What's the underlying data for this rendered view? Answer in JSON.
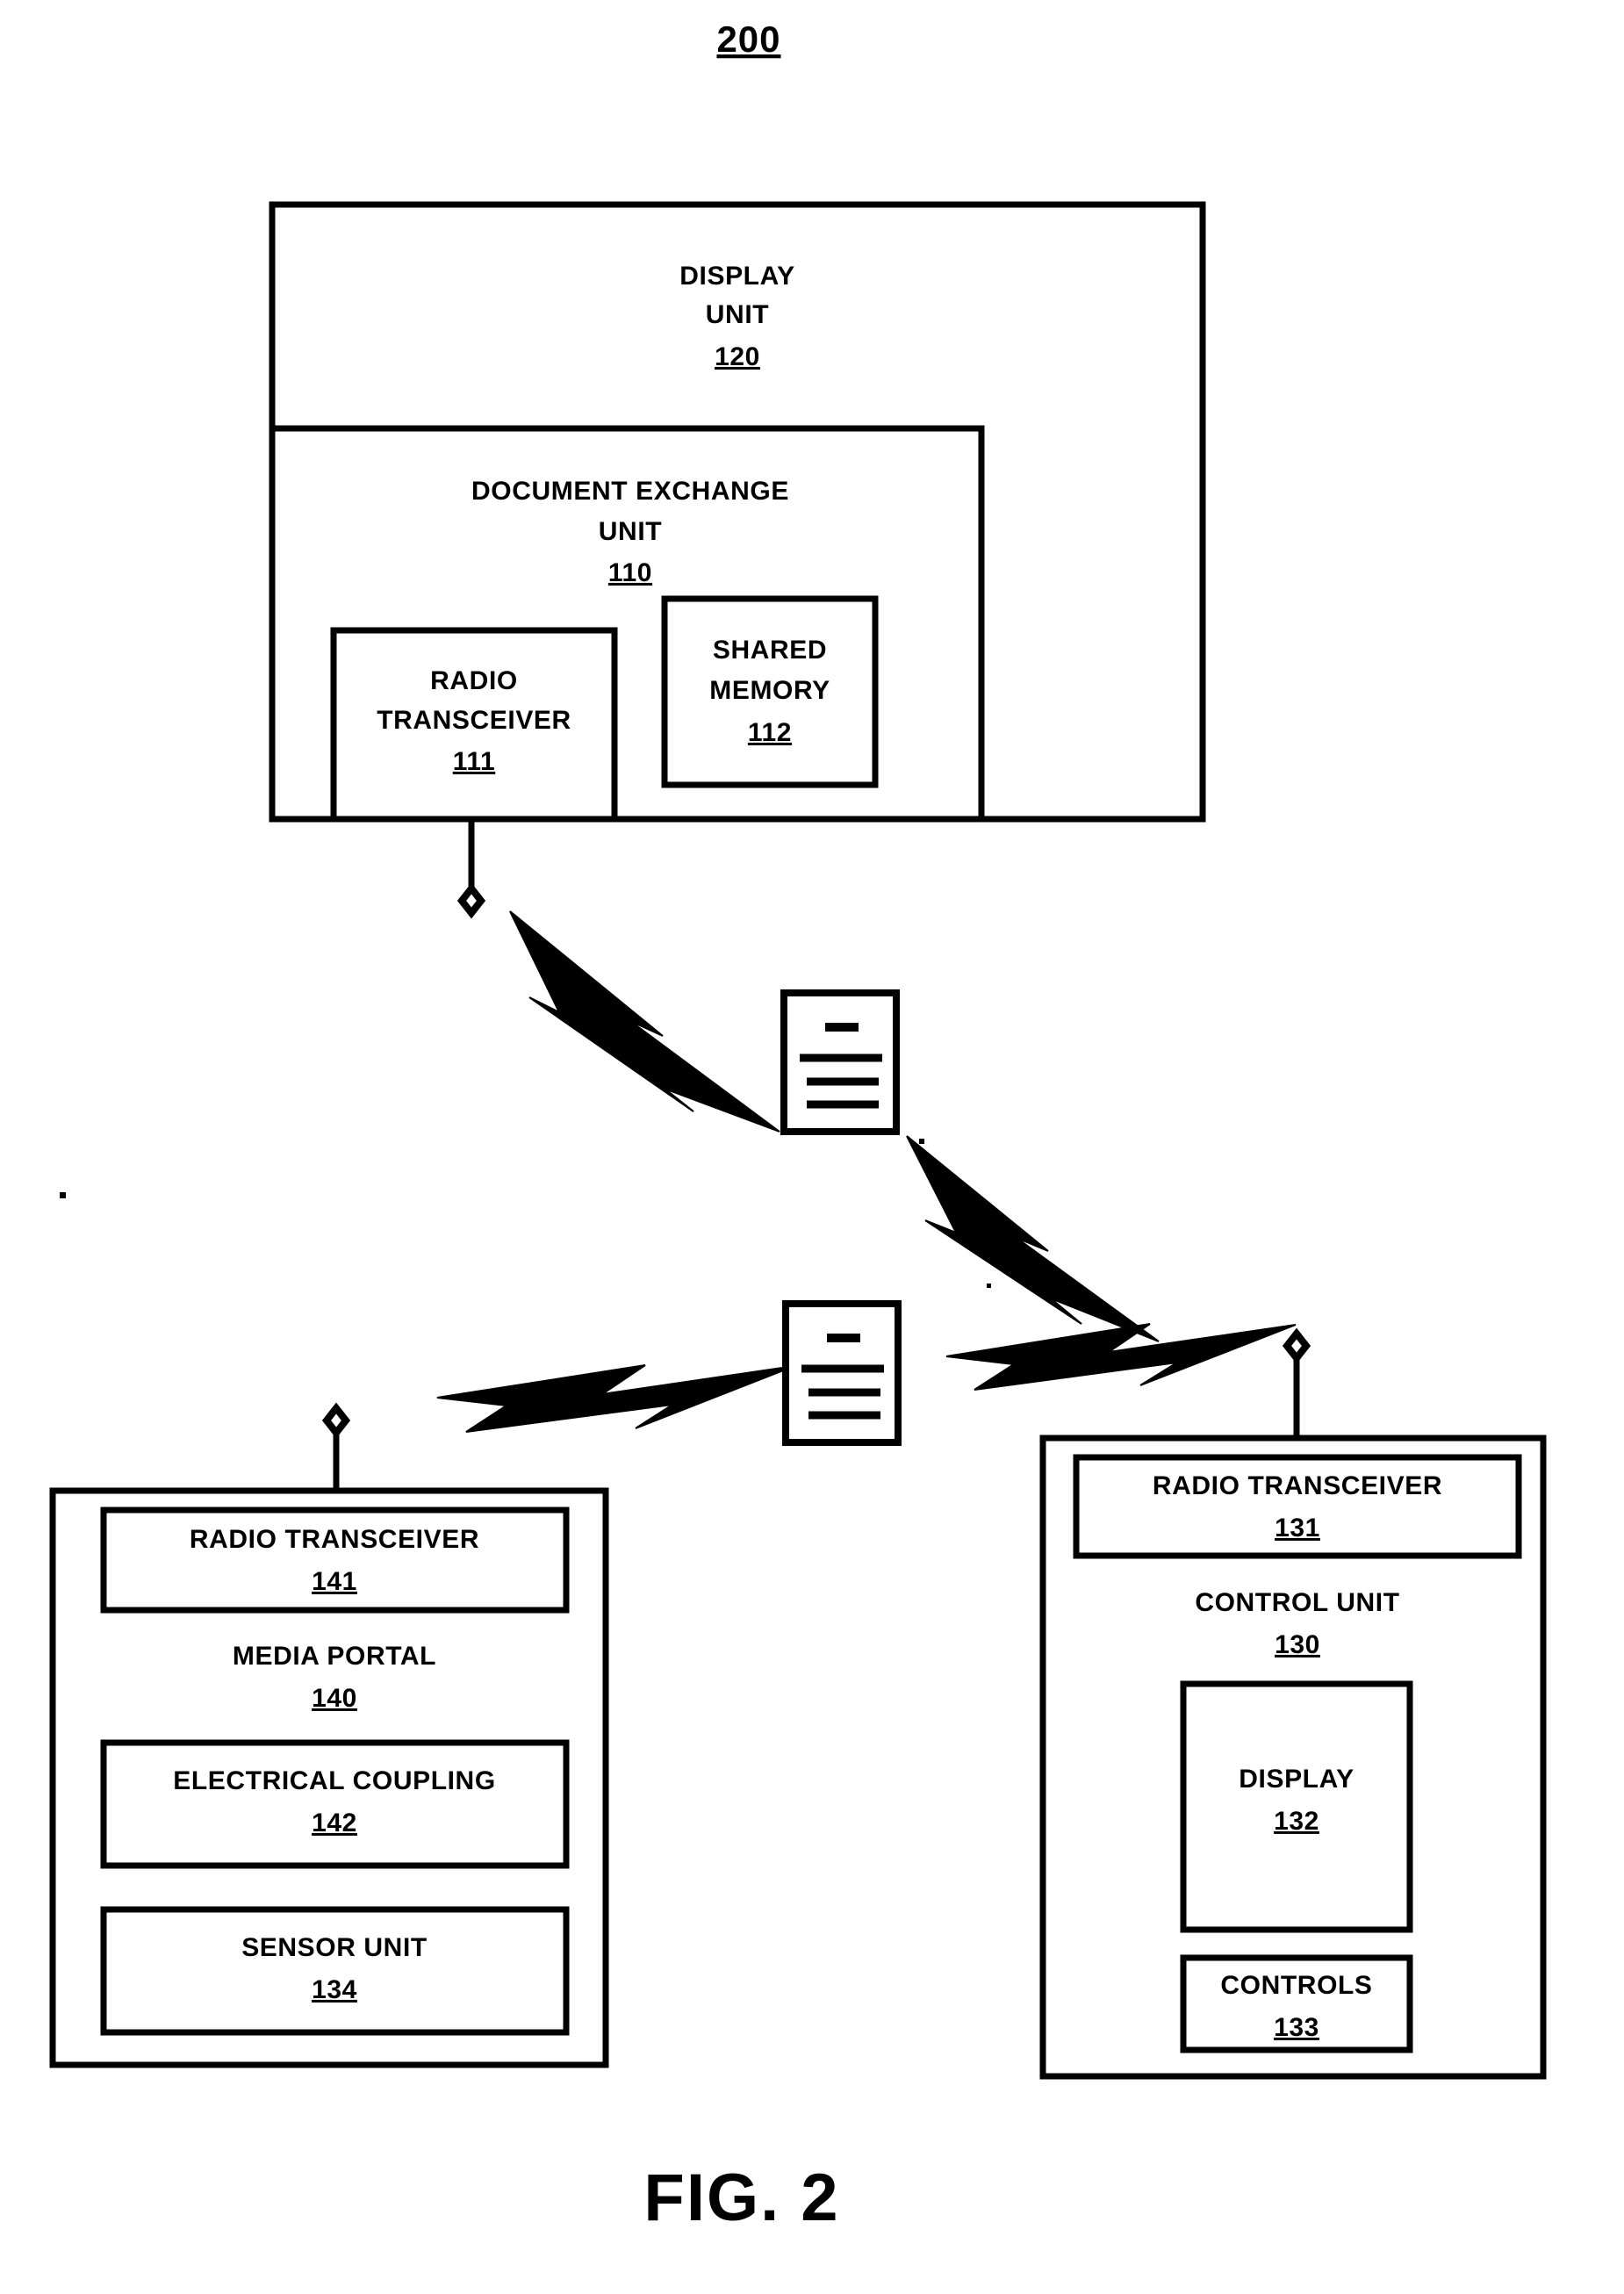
{
  "figure": {
    "reference_number": "200",
    "caption": "FIG. 2"
  },
  "blocks": {
    "display_unit": {
      "label_line1": "DISPLAY",
      "label_line2": "UNIT",
      "number": "120"
    },
    "document_exchange_unit": {
      "label_line1": "DOCUMENT EXCHANGE",
      "label_line2": "UNIT",
      "number": "110"
    },
    "radio_transceiver_111": {
      "label_line1": "RADIO",
      "label_line2": "TRANSCEIVER",
      "number": "111"
    },
    "shared_memory": {
      "label_line1": "SHARED",
      "label_line2": "MEMORY",
      "number": "112"
    },
    "media_portal": {
      "label": "MEDIA PORTAL",
      "number": "140"
    },
    "radio_transceiver_141": {
      "label": "RADIO TRANSCEIVER",
      "number": "141"
    },
    "electrical_coupling": {
      "label": "ELECTRICAL COUPLING",
      "number": "142"
    },
    "sensor_unit": {
      "label": "SENSOR UNIT",
      "number": "134"
    },
    "control_unit": {
      "label": "CONTROL UNIT",
      "number": "130"
    },
    "radio_transceiver_131": {
      "label": "RADIO TRANSCEIVER",
      "number": "131"
    },
    "display_132": {
      "label": "DISPLAY",
      "number": "132"
    },
    "controls_133": {
      "label": "CONTROLS",
      "number": "133"
    }
  },
  "icons": {
    "document_icon_upper": "document-icon",
    "document_icon_lower": "document-icon",
    "antenna_top": "antenna-icon",
    "antenna_media_portal": "antenna-icon",
    "antenna_control_unit": "antenna-icon",
    "bolt_upper_left": "lightning-bolt-icon",
    "bolt_upper_right": "lightning-bolt-icon",
    "bolt_lower_left": "lightning-bolt-icon",
    "bolt_lower_right": "lightning-bolt-icon"
  },
  "colors": {
    "ink": "#000000",
    "paper": "#ffffff"
  }
}
